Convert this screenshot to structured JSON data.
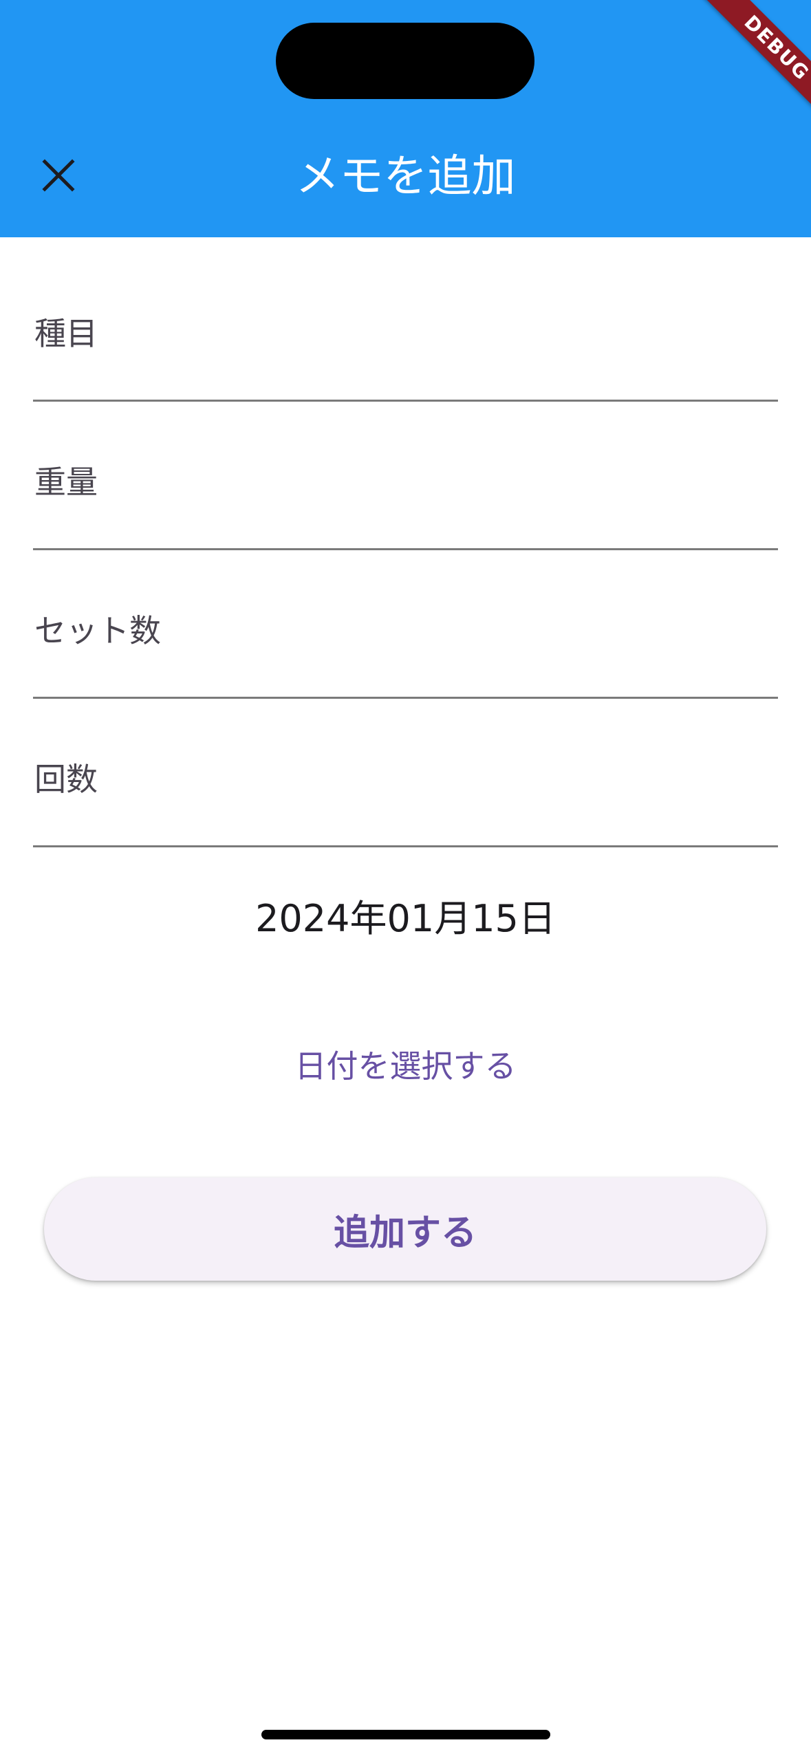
{
  "appbar": {
    "title": "メモを追加",
    "close_icon": "close-icon",
    "background_color": "#2196F3"
  },
  "debug_banner": "DEBUG",
  "form": {
    "fields": [
      {
        "label": "種目",
        "value": ""
      },
      {
        "label": "重量",
        "value": ""
      },
      {
        "label": "セット数",
        "value": ""
      },
      {
        "label": "回数",
        "value": ""
      }
    ],
    "date": "2024年01月15日",
    "pick_date_label": "日付を選択する",
    "submit_label": "追加する"
  },
  "colors": {
    "accent": "#6750A4",
    "debug_ribbon": "#8E1A24"
  }
}
